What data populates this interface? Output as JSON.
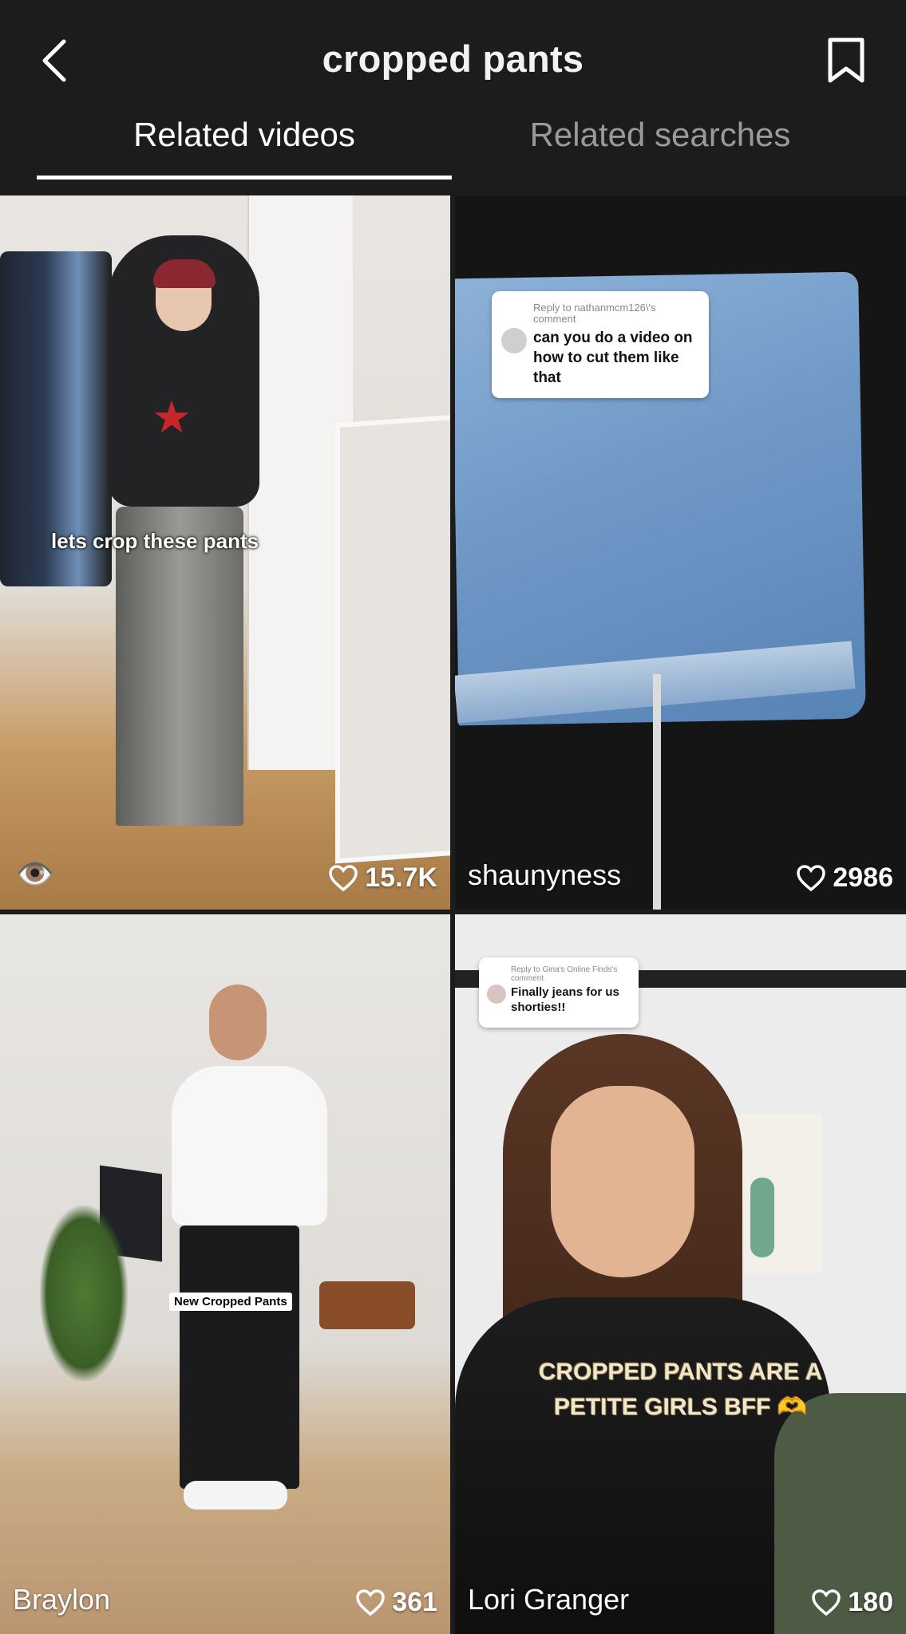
{
  "header": {
    "title": "cropped pants",
    "back_icon": "chevron-left-icon",
    "bookmark_icon": "bookmark-icon"
  },
  "tabs": [
    {
      "label": "Related videos",
      "active": true
    },
    {
      "label": "Related searches",
      "active": false
    }
  ],
  "videos": [
    {
      "caption": "lets crop these pants",
      "likes": "15.7K",
      "badge": "👁️"
    },
    {
      "comment_reply_to": "Reply to nathanmcm126\\'s comment",
      "comment_text": "can you do a video on how to cut them like that",
      "author": "shaunyness",
      "likes": "2986"
    },
    {
      "label": "New Cropped Pants",
      "author": "Braylon",
      "likes": "361"
    },
    {
      "comment_reply_to": "Reply to Gina's Online Finds's comment",
      "comment_text": "Finally jeans for us shorties!!",
      "caption": "CROPPED PANTS ARE A PETITE GIRLS BFF 🫶",
      "author": "Lori Granger",
      "likes": "180"
    }
  ],
  "colors": {
    "background": "#1c1c1c",
    "active_tab": "#ffffff",
    "inactive_tab": "#9a9a9a"
  }
}
